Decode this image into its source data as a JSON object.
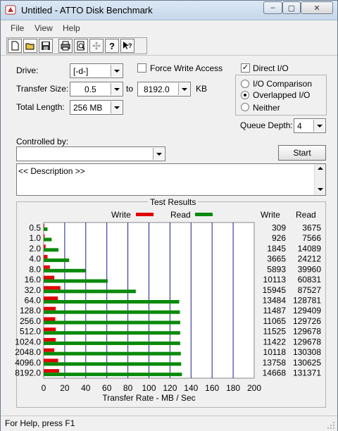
{
  "window": {
    "title": "Untitled - ATTO Disk Benchmark",
    "buttons": {
      "minimize": "–",
      "maximize": "▢",
      "close": "✕"
    }
  },
  "menu": [
    "File",
    "View",
    "Help"
  ],
  "toolbar": {
    "icons": [
      "new-file-icon",
      "open-folder-icon",
      "save-icon",
      "print-icon",
      "print-preview-icon",
      "move-icon",
      "help-icon",
      "context-help-icon"
    ]
  },
  "form": {
    "drive_label": "Drive:",
    "drive_value": "[-d-]",
    "force_write_label": "Force Write Access",
    "force_write_checked": false,
    "direct_io_label": "Direct I/O",
    "direct_io_checked": true,
    "transfer_size_label": "Transfer Size:",
    "transfer_from": "0.5",
    "transfer_to_label": "to",
    "transfer_to": "8192.0",
    "transfer_unit": "KB",
    "total_length_label": "Total Length:",
    "total_length_value": "256 MB",
    "io_options": [
      {
        "label": "I/O Comparison",
        "selected": false
      },
      {
        "label": "Overlapped I/O",
        "selected": true
      },
      {
        "label": "Neither",
        "selected": false
      }
    ],
    "queue_depth_label": "Queue Depth:",
    "queue_depth_value": "4",
    "controlled_by_label": "Controlled by:",
    "controlled_by_value": "",
    "start_button": "Start",
    "description": "<< Description >>"
  },
  "results": {
    "title": "Test Results",
    "legend_write": "Write",
    "legend_read": "Read",
    "col_write": "Write",
    "col_read": "Read"
  },
  "status": "For Help, press F1",
  "colors": {
    "write": "#e00000",
    "read": "#0a8a0a",
    "grid": "#1c1c8c"
  },
  "chart_data": {
    "type": "bar",
    "orientation": "horizontal",
    "categories": [
      "0.5",
      "1.0",
      "2.0",
      "4.0",
      "8.0",
      "16.0",
      "32.0",
      "64.0",
      "128.0",
      "256.0",
      "512.0",
      "1024.0",
      "2048.0",
      "4096.0",
      "8192.0"
    ],
    "series": [
      {
        "name": "Write",
        "values": [
          309,
          926,
          1845,
          3665,
          5893,
          10113,
          15945,
          13484,
          11487,
          11065,
          11525,
          11422,
          10118,
          13758,
          14668
        ]
      },
      {
        "name": "Read",
        "values": [
          3675,
          7566,
          14089,
          24212,
          39960,
          60831,
          87527,
          128781,
          129409,
          129726,
          129678,
          129678,
          130308,
          130625,
          131371
        ]
      }
    ],
    "xlabel": "Transfer Rate - MB / Sec",
    "xlim": [
      0,
      200
    ],
    "xticks": [
      "0",
      "20",
      "40",
      "60",
      "80",
      "100",
      "120",
      "140",
      "160",
      "180",
      "200"
    ],
    "grid": true
  }
}
